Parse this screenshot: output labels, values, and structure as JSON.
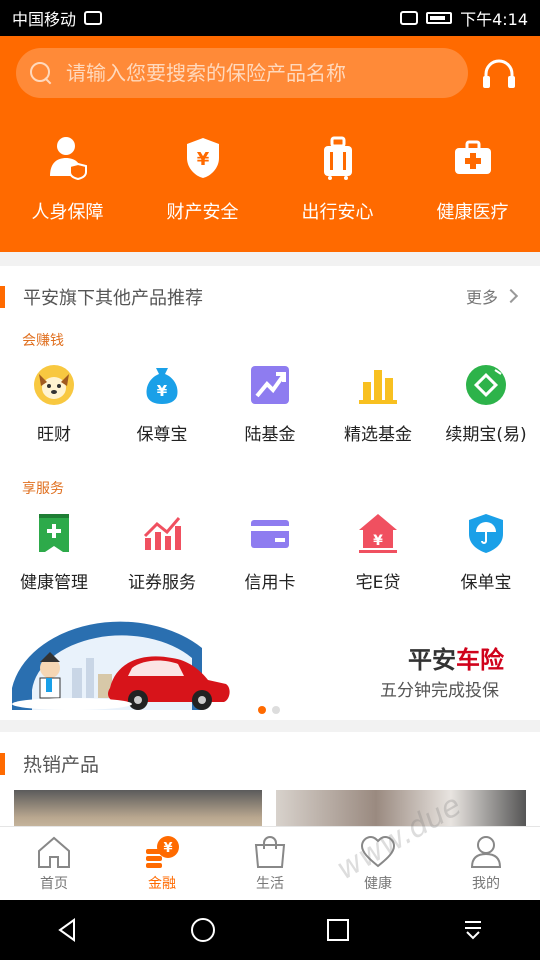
{
  "status_bar": {
    "carrier": "中国移动",
    "time": "下午4:14"
  },
  "search": {
    "placeholder": "请输入您要搜索的保险产品名称"
  },
  "top_categories": [
    {
      "label": "人身保障",
      "icon": "person-shield-icon"
    },
    {
      "label": "财产安全",
      "icon": "yen-shield-icon"
    },
    {
      "label": "出行安心",
      "icon": "luggage-icon"
    },
    {
      "label": "健康医疗",
      "icon": "medical-kit-icon"
    }
  ],
  "recommend": {
    "title": "平安旗下其他产品推荐",
    "more": "更多",
    "earn": {
      "subtitle": "会赚钱",
      "items": [
        {
          "label": "旺财",
          "icon": "dog-icon"
        },
        {
          "label": "保尊宝",
          "icon": "money-bag-icon"
        },
        {
          "label": "陆基金",
          "icon": "chart-up-icon"
        },
        {
          "label": "精选基金",
          "icon": "bar-chart-icon"
        },
        {
          "label": "续期宝(易)",
          "icon": "renew-icon"
        }
      ]
    },
    "service": {
      "subtitle": "享服务",
      "items": [
        {
          "label": "健康管理",
          "icon": "health-book-icon"
        },
        {
          "label": "证券服务",
          "icon": "stock-chart-icon"
        },
        {
          "label": "信用卡",
          "icon": "credit-card-icon"
        },
        {
          "label": "宅E贷",
          "icon": "house-loan-icon"
        },
        {
          "label": "保单宝",
          "icon": "umbrella-shield-icon"
        }
      ]
    },
    "banner": {
      "title_prefix": "平安",
      "title_highlight": "车险",
      "subtitle": "五分钟完成投保"
    }
  },
  "hot": {
    "title": "热销产品"
  },
  "tabs": [
    {
      "label": "首页",
      "icon": "home-icon",
      "active": false
    },
    {
      "label": "金融",
      "icon": "finance-icon",
      "active": true
    },
    {
      "label": "生活",
      "icon": "shopping-bag-icon",
      "active": false
    },
    {
      "label": "健康",
      "icon": "heart-icon",
      "active": false
    },
    {
      "label": "我的",
      "icon": "user-icon",
      "active": false
    }
  ],
  "colors": {
    "brand": "#ff6a00",
    "banner_red": "#d0021b"
  },
  "watermark": "www.due"
}
